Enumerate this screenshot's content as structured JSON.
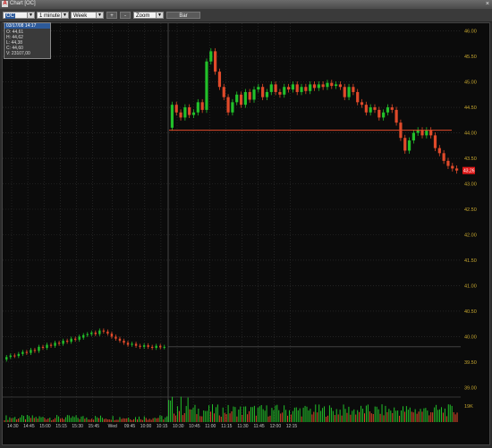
{
  "window": {
    "title": "Chart [OC]",
    "close": "×"
  },
  "toolbar": {
    "symbol": "OC",
    "interval": "1 minute",
    "range": "Week",
    "plus": "+",
    "minus": "-",
    "mode": "Zoom",
    "chart_type": "Bar"
  },
  "ohlc_box": {
    "header": "03/17/08 14:17",
    "open": "O: 44,61",
    "high": "H: 44,62",
    "low": "L: 44,38",
    "close": "C: 44,60",
    "volume": "V: 23107,00"
  },
  "colors": {
    "up": "#22c02a",
    "down": "#e04a2a",
    "grid": "#333333",
    "ref_line": "#e04a2a",
    "axis_text": "#c8a830",
    "price_tag": "#e01818"
  },
  "chart_data": {
    "type": "candlestick",
    "y_axis_labels": [
      "46.00",
      "45.50",
      "45.00",
      "44.50",
      "44.00",
      "43.50",
      "43.00",
      "42.50",
      "42.00",
      "41.50",
      "41.00",
      "40.50",
      "40.00",
      "39.50",
      "39.00"
    ],
    "ylim": [
      38.85,
      46.15
    ],
    "x_tick_labels": [
      "14:30",
      "14:45",
      "15:00",
      "15:15",
      "15:30",
      "15:45",
      "Wed",
      "09:45",
      "10:00",
      "10:15",
      "10:30",
      "10:45",
      "11:00",
      "11:15",
      "11:30",
      "11:45",
      "12:00",
      "12:15"
    ],
    "current_price_tag": "43,26",
    "reference_price": 44.05,
    "previous_close_line": 39.8,
    "volume_axis_label": "19K",
    "prev_session": [
      [
        39.55,
        39.6
      ],
      [
        39.6,
        39.63
      ],
      [
        39.63,
        39.62
      ],
      [
        39.62,
        39.66
      ],
      [
        39.66,
        39.7
      ],
      [
        39.7,
        39.68
      ],
      [
        39.68,
        39.74
      ],
      [
        39.74,
        39.72
      ],
      [
        39.72,
        39.8
      ],
      [
        39.8,
        39.78
      ],
      [
        39.78,
        39.84
      ],
      [
        39.84,
        39.82
      ],
      [
        39.82,
        39.88
      ],
      [
        39.88,
        39.86
      ],
      [
        39.86,
        39.92
      ],
      [
        39.92,
        39.9
      ],
      [
        39.9,
        39.96
      ],
      [
        39.96,
        39.94
      ],
      [
        39.94,
        40.0
      ],
      [
        39.98,
        40.03
      ],
      [
        40.03,
        40.05
      ],
      [
        40.05,
        40.08
      ],
      [
        40.08,
        40.05
      ],
      [
        40.05,
        40.12
      ],
      [
        40.12,
        40.1
      ],
      [
        40.1,
        40.06
      ],
      [
        40.06,
        40.0
      ],
      [
        40.0,
        39.96
      ],
      [
        39.96,
        39.92
      ],
      [
        39.92,
        39.88
      ],
      [
        39.88,
        39.84
      ],
      [
        39.84,
        39.86
      ],
      [
        39.86,
        39.82
      ],
      [
        39.82,
        39.8
      ],
      [
        39.8,
        39.83
      ],
      [
        39.83,
        39.8
      ],
      [
        39.8,
        39.78
      ],
      [
        39.78,
        39.82
      ],
      [
        39.82,
        39.79
      ],
      [
        39.79,
        39.8
      ]
    ],
    "session": [
      [
        44.1,
        44.55
      ],
      [
        44.55,
        44.4
      ],
      [
        44.4,
        44.3
      ],
      [
        44.3,
        44.5
      ],
      [
        44.5,
        44.35
      ],
      [
        44.35,
        44.4
      ],
      [
        44.4,
        44.6
      ],
      [
        44.6,
        44.45
      ],
      [
        44.45,
        45.4
      ],
      [
        45.4,
        45.6
      ],
      [
        45.6,
        45.2
      ],
      [
        45.2,
        44.9
      ],
      [
        44.9,
        44.7
      ],
      [
        44.7,
        44.4
      ],
      [
        44.4,
        44.6
      ],
      [
        44.6,
        44.75
      ],
      [
        44.75,
        44.55
      ],
      [
        44.55,
        44.8
      ],
      [
        44.8,
        44.65
      ],
      [
        44.65,
        44.85
      ],
      [
        44.85,
        44.9
      ],
      [
        44.9,
        44.7
      ],
      [
        44.7,
        44.8
      ],
      [
        44.8,
        44.95
      ],
      [
        44.95,
        44.8
      ],
      [
        44.8,
        44.75
      ],
      [
        44.75,
        44.9
      ],
      [
        44.9,
        44.85
      ],
      [
        44.85,
        44.95
      ],
      [
        44.95,
        44.8
      ],
      [
        44.8,
        44.9
      ],
      [
        44.9,
        44.82
      ],
      [
        44.82,
        44.95
      ],
      [
        44.95,
        44.88
      ],
      [
        44.88,
        44.95
      ],
      [
        44.95,
        44.9
      ],
      [
        44.9,
        44.98
      ],
      [
        44.98,
        44.92
      ],
      [
        44.92,
        44.95
      ],
      [
        44.95,
        44.9
      ],
      [
        44.9,
        44.7
      ],
      [
        44.7,
        44.9
      ],
      [
        44.9,
        44.8
      ],
      [
        44.8,
        44.6
      ],
      [
        44.6,
        44.55
      ],
      [
        44.55,
        44.4
      ],
      [
        44.4,
        44.5
      ],
      [
        44.5,
        44.45
      ],
      [
        44.45,
        44.3
      ],
      [
        44.3,
        44.4
      ],
      [
        44.4,
        44.5
      ],
      [
        44.5,
        44.45
      ],
      [
        44.45,
        44.2
      ],
      [
        44.2,
        43.9
      ],
      [
        43.9,
        43.65
      ],
      [
        43.65,
        43.85
      ],
      [
        43.85,
        44.0
      ],
      [
        44.0,
        44.05
      ],
      [
        44.05,
        43.95
      ],
      [
        43.95,
        44.05
      ],
      [
        44.05,
        43.95
      ],
      [
        43.95,
        43.7
      ],
      [
        43.7,
        43.6
      ],
      [
        43.6,
        43.45
      ],
      [
        43.45,
        43.35
      ],
      [
        43.35,
        43.3
      ],
      [
        43.3,
        43.26
      ]
    ]
  }
}
